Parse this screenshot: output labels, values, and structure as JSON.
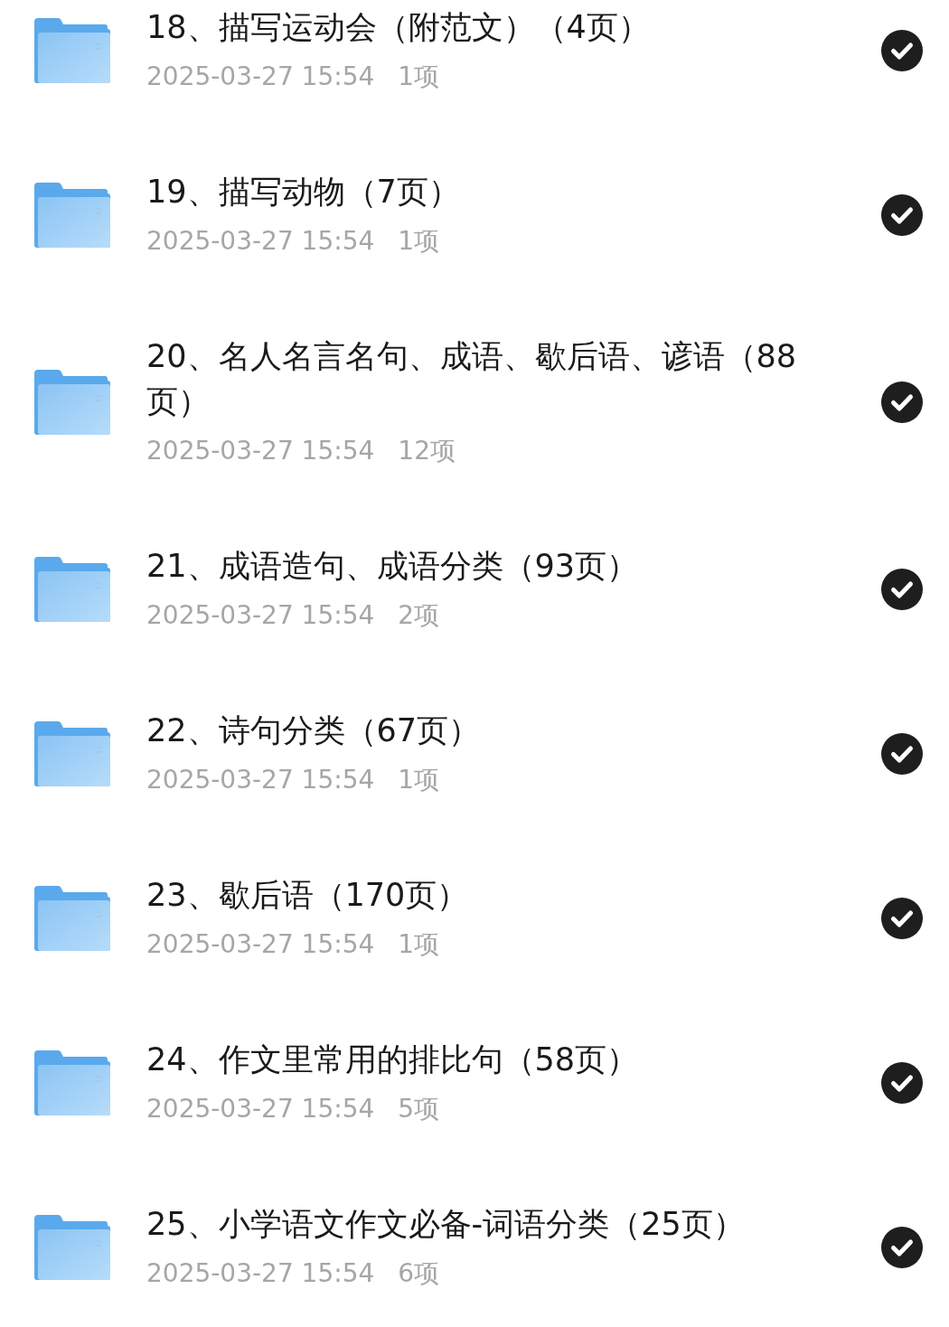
{
  "folders": [
    {
      "name": "18、描写运动会（附范文）（4页）",
      "modified": "2025-03-27 15:54",
      "count": "1项",
      "checked": true
    },
    {
      "name": "19、描写动物（7页）",
      "modified": "2025-03-27 15:54",
      "count": "1项",
      "checked": true
    },
    {
      "name": "20、名人名言名句、成语、歇后语、谚语（88页）",
      "modified": "2025-03-27 15:54",
      "count": "12项",
      "checked": true
    },
    {
      "name": "21、成语造句、成语分类（93页）",
      "modified": "2025-03-27 15:54",
      "count": "2项",
      "checked": true
    },
    {
      "name": "22、诗句分类（67页）",
      "modified": "2025-03-27 15:54",
      "count": "1项",
      "checked": true
    },
    {
      "name": "23、歇后语（170页）",
      "modified": "2025-03-27 15:54",
      "count": "1项",
      "checked": true
    },
    {
      "name": "24、作文里常用的排比句（58页）",
      "modified": "2025-03-27 15:54",
      "count": "5项",
      "checked": true
    },
    {
      "name": "25、小学语文作文必备-词语分类（25页）",
      "modified": "2025-03-27 15:54",
      "count": "6项",
      "checked": true
    }
  ]
}
